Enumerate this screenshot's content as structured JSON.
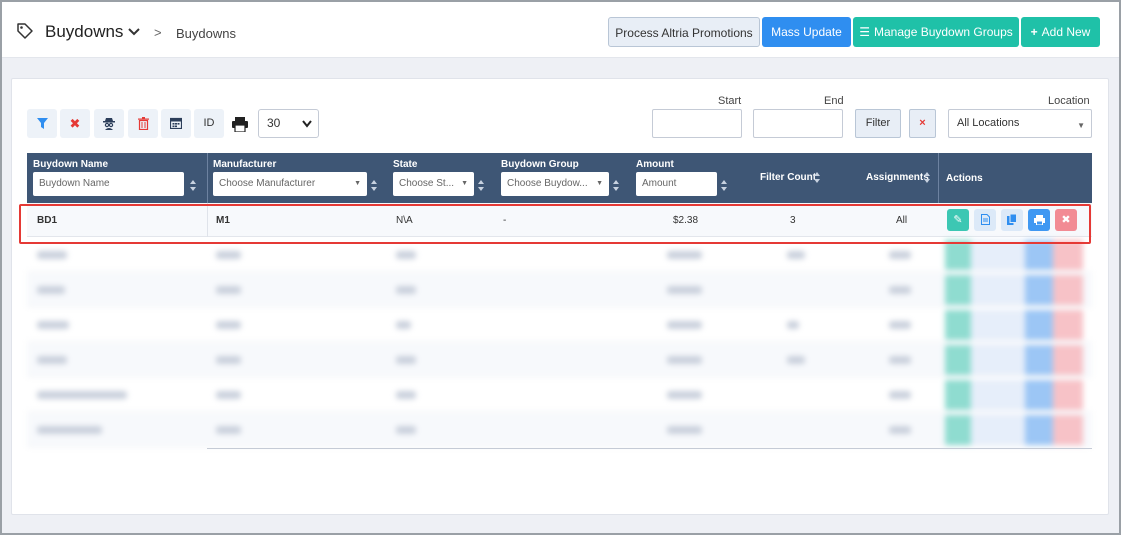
{
  "header": {
    "title": "Buydowns",
    "breadcrumb_sep": ">",
    "breadcrumb": "Buydowns",
    "buttons": {
      "process_altria": "Process Altria Promotions",
      "mass_update": "Mass Update",
      "manage_groups": "Manage Buydown Groups",
      "add_new": "Add New"
    }
  },
  "toolbar": {
    "id_label": "ID",
    "page_size": "30",
    "start_label": "Start",
    "end_label": "End",
    "filter_label": "Filter",
    "clear_label": "×",
    "location_label": "Location",
    "location_value": "All Locations"
  },
  "table": {
    "columns": {
      "name": "Buydown Name",
      "manufacturer": "Manufacturer",
      "state": "State",
      "group": "Buydown Group",
      "amount": "Amount",
      "filter_count": "Filter Count",
      "assignments": "Assignments",
      "actions": "Actions"
    },
    "filters": {
      "name_placeholder": "Buydown Name",
      "manufacturer_placeholder": "Choose Manufacturer",
      "state_placeholder": "Choose St...",
      "group_placeholder": "Choose Buydow...",
      "amount_placeholder": "Amount"
    },
    "rows": [
      {
        "name": "BD1",
        "manufacturer": "M1",
        "state": "N\\A",
        "group": "-",
        "amount": "$2.38",
        "filter_count": "3",
        "assignments": "All"
      }
    ]
  },
  "colors": {
    "header_bg": "#3e5675",
    "primary": "#2f8ef0",
    "teal": "#1fc1a8",
    "danger": "#e53935"
  },
  "icons": [
    "tag-icon",
    "chevron-down-icon",
    "filter-icon",
    "close-icon",
    "spy-icon",
    "trash-icon",
    "calendar-icon",
    "print-icon",
    "edit-icon",
    "document-icon",
    "copy-icon",
    "delete-icon",
    "list-icon",
    "plus-icon"
  ]
}
